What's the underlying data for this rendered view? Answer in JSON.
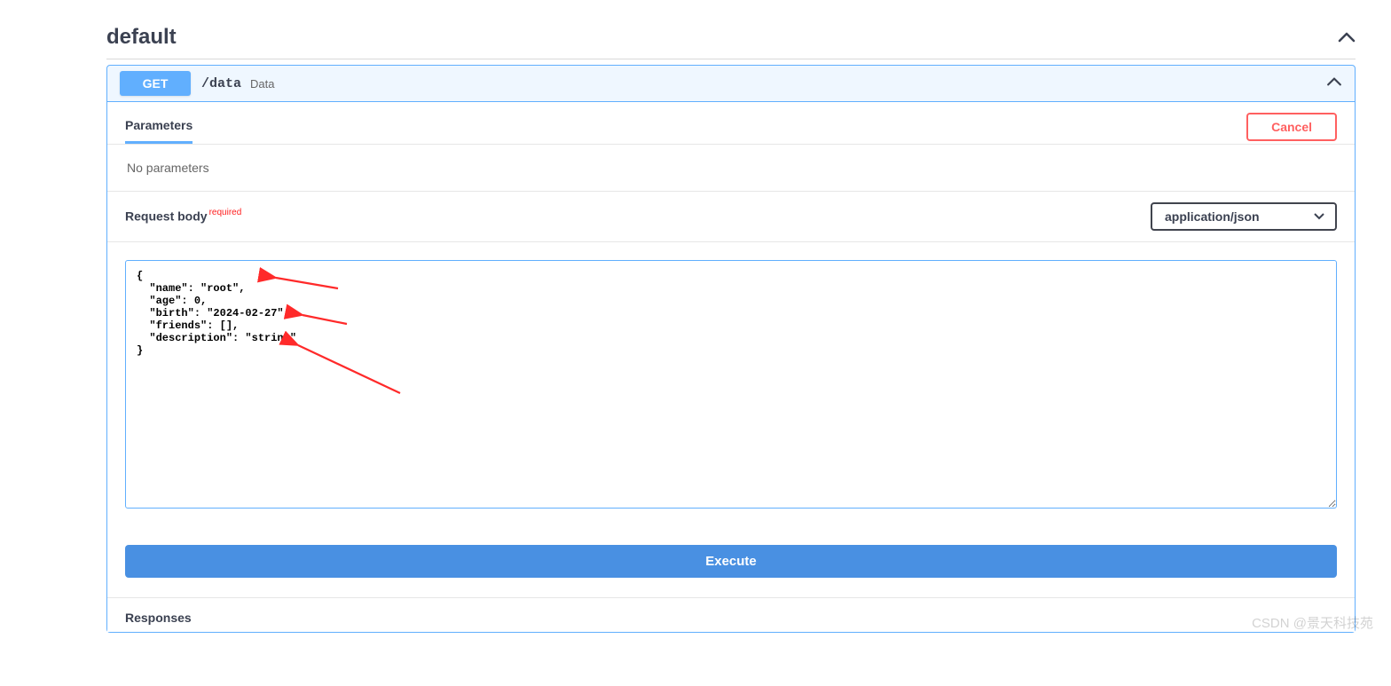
{
  "section": {
    "title": "default"
  },
  "operation": {
    "method": "GET",
    "path": "/data",
    "description": "Data"
  },
  "parameters": {
    "tab_label": "Parameters",
    "cancel_label": "Cancel",
    "empty_text": "No parameters"
  },
  "request_body": {
    "label": "Request body",
    "required_label": "required",
    "content_type": "application/json",
    "body_text": "{\n  \"name\": \"root\",\n  \"age\": 0,\n  \"birth\": \"2024-02-27\",\n  \"friends\": [],\n  \"description\": \"string\"\n}"
  },
  "execute": {
    "label": "Execute"
  },
  "responses": {
    "label": "Responses"
  },
  "watermark": "CSDN @景天科技苑"
}
